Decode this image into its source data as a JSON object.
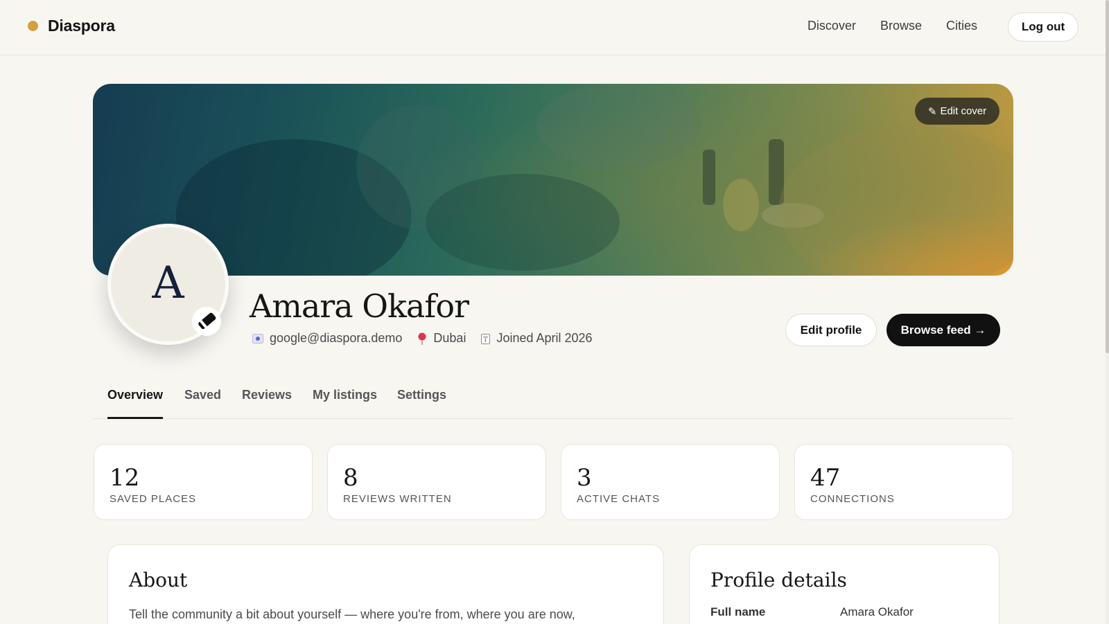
{
  "nav": {
    "brand": "Diaspora",
    "links": [
      "Discover",
      "Browse",
      "Cities"
    ],
    "logout": "Log out"
  },
  "colors": {
    "brand_dot": "#d4a03d",
    "primary_button": "#111111",
    "background": "#f8f6f1"
  },
  "cover": {
    "edit_label": "Edit cover"
  },
  "profile": {
    "initial": "A",
    "name": "Amara Okafor",
    "email": "google@diaspora.demo",
    "location": "Dubai",
    "joined": "Joined April 2026",
    "edit_profile": "Edit profile",
    "browse_feed": "Browse feed →"
  },
  "tabs": [
    "Overview",
    "Saved",
    "Reviews",
    "My listings",
    "Settings"
  ],
  "active_tab": "Overview",
  "stats": [
    {
      "value": "12",
      "label": "SAVED PLACES"
    },
    {
      "value": "8",
      "label": "REVIEWS WRITTEN"
    },
    {
      "value": "3",
      "label": "ACTIVE CHATS"
    },
    {
      "value": "47",
      "label": "CONNECTIONS"
    }
  ],
  "about": {
    "title": "About",
    "text": "Tell the community a bit about yourself — where you're from, where you are now,"
  },
  "details": {
    "title": "Profile details",
    "rows": [
      {
        "label": "Full name",
        "value": "Amara Okafor"
      }
    ]
  }
}
